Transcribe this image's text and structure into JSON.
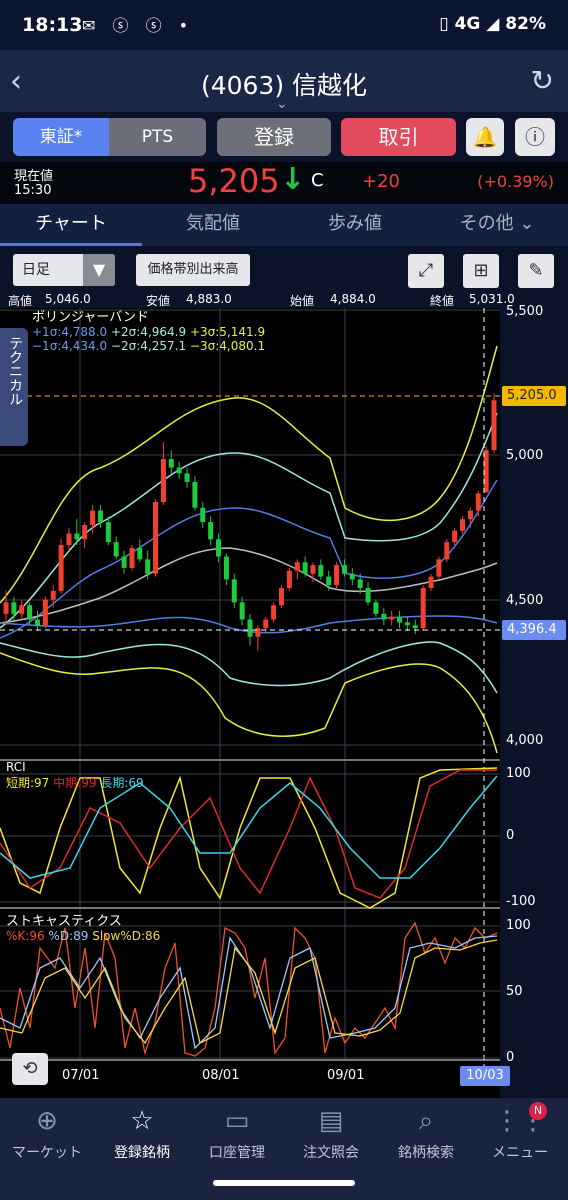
{
  "status": {
    "time": "18:13",
    "network": "4G",
    "battery": "82%",
    "icons": "✉ ⓢ ⓢ •"
  },
  "nav": {
    "back_icon": "back-arrow",
    "title": "(4063) 信越化",
    "refresh_icon": "refresh"
  },
  "buttons": {
    "market_tse": "東証*",
    "market_pts": "PTS",
    "register": "登録",
    "trade": "取引",
    "bell_icon": "bell",
    "info_icon": "info"
  },
  "price": {
    "label": "現在値",
    "time": "15:30",
    "value": "5,205",
    "arrow": "↓",
    "flag": "C",
    "change": "+20",
    "change_pct": "(+0.39%)"
  },
  "tabs": [
    "チャート",
    "気配値",
    "歩み値",
    "その他"
  ],
  "controls": {
    "period": "日足",
    "range_button": "価格帯別出来高"
  },
  "ohlc": {
    "high_label": "高値",
    "high": "5,046.0",
    "low_label": "安値",
    "low": "4,883.0",
    "open_label": "始値",
    "open": "4,884.0",
    "close_label": "終値",
    "close": "5,031.0"
  },
  "side_tab": "テクニカル",
  "bollinger": {
    "title": "ボリンジャーバンド",
    "plus1": "+1σ:4,788.0",
    "plus2": "+2σ:4,964.9",
    "plus3": "+3σ:5,141.9",
    "minus1": "−1σ:4,434.0",
    "minus2": "−2σ:4,257.1",
    "minus3": "−3σ:4,080.1"
  },
  "price_axis": {
    "ticks": [
      "5,500",
      "5,000",
      "4,500",
      "4,000"
    ],
    "current_tag": "5,205.0",
    "cursor_tag": "4,396.4"
  },
  "rci": {
    "title": "RCI",
    "short": "短期:97",
    "mid": "中期:99",
    "long": "長期:69",
    "ticks": [
      "100",
      "0",
      "-100"
    ]
  },
  "stoch": {
    "title": "ストキャスティクス",
    "k": "%K:96",
    "d": "%D:89",
    "slow": "Slow%D:86",
    "ticks": [
      "100",
      "50",
      "0"
    ]
  },
  "dates": [
    "07/01",
    "08/01",
    "09/01"
  ],
  "cursor_date": "10/03",
  "colors": {
    "up": "#f0412f",
    "down": "#1ecb3a",
    "accent": "#4a7ae8",
    "tag_yellow": "#f5b800"
  },
  "chart_data": {
    "type": "candlestick",
    "ylim": [
      3950,
      5520
    ],
    "candles": [
      [
        4460,
        4540,
        4420,
        4500
      ],
      [
        4500,
        4520,
        4430,
        4460
      ],
      [
        4460,
        4510,
        4440,
        4490
      ],
      [
        4490,
        4500,
        4420,
        4440
      ],
      [
        4440,
        4470,
        4400,
        4420
      ],
      [
        4420,
        4520,
        4410,
        4510
      ],
      [
        4510,
        4560,
        4480,
        4540
      ],
      [
        4540,
        4720,
        4530,
        4700
      ],
      [
        4700,
        4760,
        4680,
        4740
      ],
      [
        4740,
        4790,
        4700,
        4720
      ],
      [
        4720,
        4780,
        4690,
        4770
      ],
      [
        4770,
        4840,
        4740,
        4820
      ],
      [
        4820,
        4840,
        4760,
        4780
      ],
      [
        4780,
        4800,
        4700,
        4710
      ],
      [
        4710,
        4730,
        4650,
        4660
      ],
      [
        4660,
        4680,
        4600,
        4620
      ],
      [
        4620,
        4700,
        4610,
        4690
      ],
      [
        4690,
        4720,
        4640,
        4650
      ],
      [
        4650,
        4680,
        4580,
        4600
      ],
      [
        4600,
        4860,
        4590,
        4850
      ],
      [
        4850,
        5060,
        4840,
        5000
      ],
      [
        5000,
        5030,
        4950,
        4970
      ],
      [
        4970,
        4990,
        4930,
        4950
      ],
      [
        4950,
        4970,
        4900,
        4920
      ],
      [
        4920,
        4940,
        4820,
        4830
      ],
      [
        4830,
        4850,
        4760,
        4780
      ],
      [
        4780,
        4800,
        4700,
        4720
      ],
      [
        4720,
        4740,
        4640,
        4660
      ],
      [
        4660,
        4670,
        4560,
        4580
      ],
      [
        4580,
        4600,
        4480,
        4500
      ],
      [
        4500,
        4520,
        4420,
        4440
      ],
      [
        4440,
        4460,
        4350,
        4380
      ],
      [
        4380,
        4420,
        4330,
        4410
      ],
      [
        4410,
        4450,
        4390,
        4440
      ],
      [
        4440,
        4500,
        4430,
        4490
      ],
      [
        4490,
        4560,
        4480,
        4550
      ],
      [
        4550,
        4620,
        4540,
        4610
      ],
      [
        4610,
        4650,
        4580,
        4640
      ],
      [
        4640,
        4660,
        4590,
        4600
      ],
      [
        4600,
        4640,
        4570,
        4630
      ],
      [
        4630,
        4650,
        4580,
        4590
      ],
      [
        4590,
        4610,
        4540,
        4560
      ],
      [
        4560,
        4640,
        4550,
        4630
      ],
      [
        4630,
        4650,
        4590,
        4600
      ],
      [
        4600,
        4620,
        4560,
        4580
      ],
      [
        4580,
        4600,
        4530,
        4550
      ],
      [
        4550,
        4570,
        4490,
        4500
      ],
      [
        4500,
        4510,
        4450,
        4460
      ],
      [
        4460,
        4480,
        4420,
        4440
      ],
      [
        4440,
        4470,
        4420,
        4450
      ],
      [
        4450,
        4470,
        4410,
        4430
      ],
      [
        4430,
        4450,
        4400,
        4420
      ],
      [
        4420,
        4440,
        4390,
        4410
      ],
      [
        4410,
        4560,
        4400,
        4550
      ],
      [
        4550,
        4600,
        4540,
        4590
      ],
      [
        4590,
        4660,
        4580,
        4650
      ],
      [
        4650,
        4720,
        4640,
        4710
      ],
      [
        4710,
        4760,
        4700,
        4750
      ],
      [
        4750,
        4800,
        4740,
        4790
      ],
      [
        4790,
        4830,
        4760,
        4820
      ],
      [
        4820,
        4890,
        4800,
        4880
      ],
      [
        4884,
        5046,
        4883,
        5031
      ],
      [
        5031,
        5230,
        5020,
        5205
      ]
    ]
  }
}
